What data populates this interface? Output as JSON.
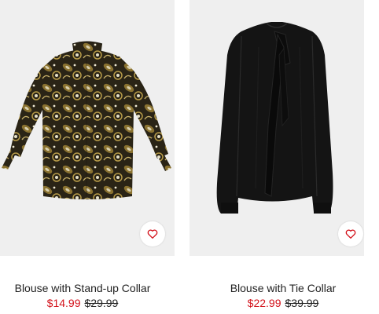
{
  "products": [
    {
      "title": "Blouse with Stand-up Collar",
      "sale_price": "$14.99",
      "original_price": "$29.99",
      "favorite_icon": "heart-outline-icon"
    },
    {
      "title": "Blouse with Tie Collar",
      "sale_price": "$22.99",
      "original_price": "$39.99",
      "favorite_icon": "heart-outline-icon"
    }
  ],
  "colors": {
    "image_background": "#efefef",
    "sale_price": "#d3111a",
    "text": "#222222",
    "favorite_heart": "#d3111a"
  }
}
